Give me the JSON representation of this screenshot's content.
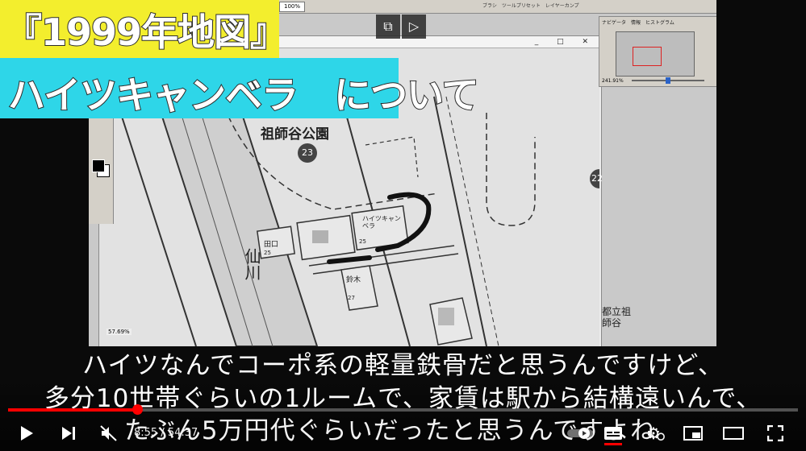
{
  "video": {
    "title_line1": "『1999年地図』",
    "title_line2": "ハイツキャンベラ　について",
    "captions": [
      "ハイツなんでコーポ系の軽量鉄骨だと思うんですけど、",
      "多分10世帯ぐらいの1ルームで、家賃は駅から結構遠いんで、",
      "たぶん5万円代ぐらいだったと思うんですよね。"
    ]
  },
  "photoshop": {
    "zoom_value": "100%",
    "top_tabs": "ブラシ　ツールプリセット　レイヤーカンプ",
    "window_buttons": "_ □ ✕",
    "status_zoom": "57.69%",
    "navigator": {
      "tabs": "ナビゲータ　情報　ヒストグラム",
      "zoom": "241.91%"
    }
  },
  "map": {
    "park_label": "祖師谷公園",
    "park_number": "23",
    "marker_right": "22",
    "building_main": "ハイツキャンベラ",
    "building_main_sub": "ハイツ",
    "building_main_no": "25",
    "building_left": "田口",
    "building_left_no": "25",
    "building_below": "鈴木",
    "building_below_no": "27",
    "river_label": "仙川",
    "bottom_right_label": "都立祖師谷"
  },
  "player": {
    "time": "8:55 / 54:37",
    "progress": 0.163,
    "icons": {
      "play": "play-icon",
      "next": "next-icon",
      "mute": "volume-muted-icon",
      "autoplay": "autoplay-toggle-icon",
      "captions": "captions-icon",
      "settings": "settings-icon",
      "miniplayer": "miniplayer-icon",
      "theater": "theater-icon",
      "fullscreen": "fullscreen-icon"
    }
  }
}
